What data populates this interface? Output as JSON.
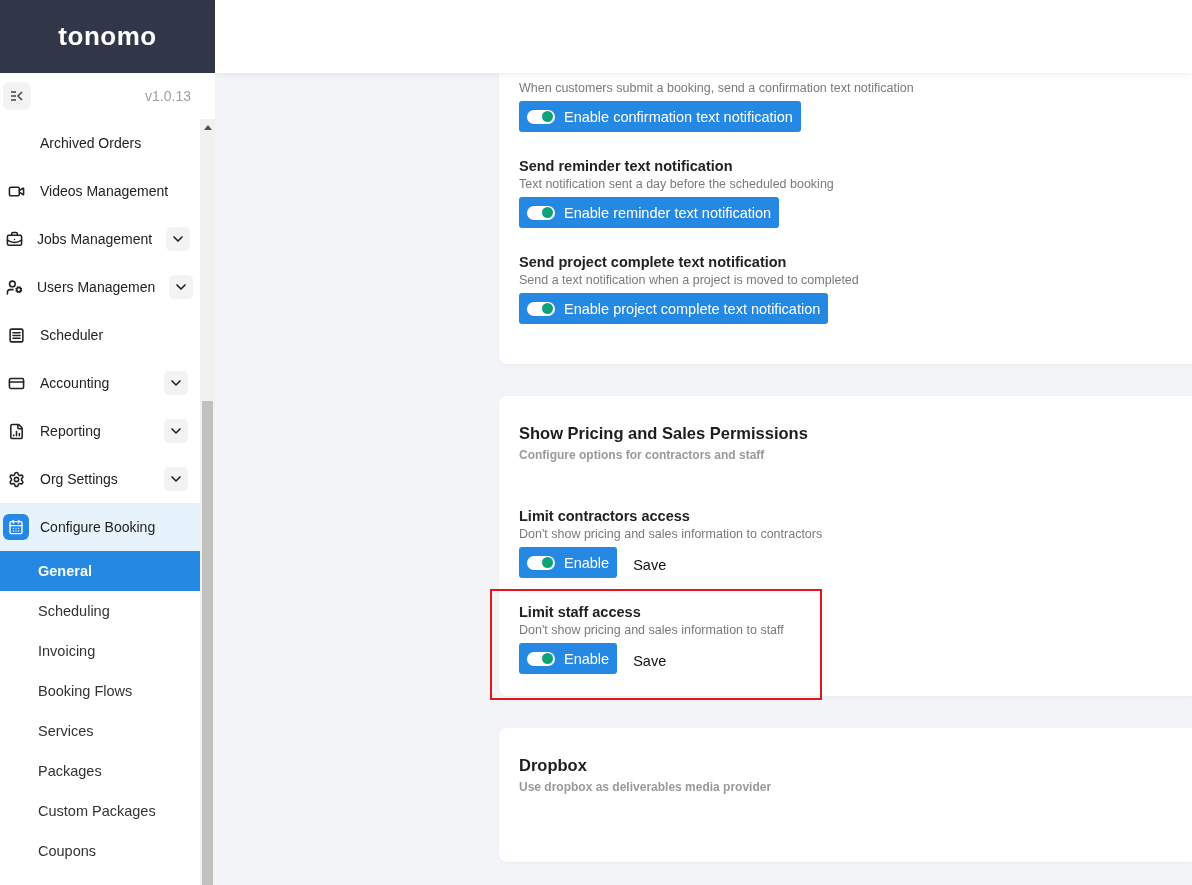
{
  "logo": "tonomo",
  "version": "v1.0.13",
  "sidebar": {
    "items": [
      {
        "label": "Archived Orders",
        "expandable": false,
        "selected": false
      },
      {
        "label": "Videos Management",
        "expandable": false,
        "selected": false
      },
      {
        "label": "Jobs Management",
        "expandable": true,
        "selected": false
      },
      {
        "label": "Users Managemen",
        "expandable": true,
        "selected": false
      },
      {
        "label": "Scheduler",
        "expandable": false,
        "selected": false
      },
      {
        "label": "Accounting",
        "expandable": true,
        "selected": false
      },
      {
        "label": "Reporting",
        "expandable": true,
        "selected": false
      },
      {
        "label": "Org Settings",
        "expandable": true,
        "selected": false
      },
      {
        "label": "Configure Booking",
        "expandable": false,
        "selected": true,
        "children": [
          {
            "label": "General",
            "selected": true
          },
          {
            "label": "Scheduling",
            "selected": false
          },
          {
            "label": "Invoicing",
            "selected": false
          },
          {
            "label": "Booking Flows",
            "selected": false
          },
          {
            "label": "Services",
            "selected": false
          },
          {
            "label": "Packages",
            "selected": false
          },
          {
            "label": "Custom Packages",
            "selected": false
          },
          {
            "label": "Coupons",
            "selected": false
          }
        ]
      }
    ]
  },
  "cards": [
    {
      "clipped": true,
      "settings": [
        {
          "description": "When customers submit a booking, send a confirmation text notification",
          "toggle": {
            "label": "Enable confirmation text notification",
            "on": true
          },
          "highlighted": false
        },
        {
          "title": "Send reminder text notification",
          "description": "Text notification sent a day before the scheduled booking",
          "toggle": {
            "label": "Enable reminder text notification",
            "on": true
          },
          "highlighted": false
        },
        {
          "title": "Send project complete text notification",
          "description": "Send a text notification when a project is moved to completed",
          "toggle": {
            "label": "Enable project complete text notification",
            "on": true
          },
          "highlighted": false
        }
      ]
    },
    {
      "clipped": false,
      "title": "Show Pricing and Sales Permissions",
      "subtitle": "Configure options for contractors and staff",
      "settings": [
        {
          "title": "Limit contractors access",
          "description": "Don't show pricing and sales information to contractors",
          "toggle": {
            "label": "Enable",
            "on": true
          },
          "save": "Save",
          "highlighted": false
        },
        {
          "title": "Limit staff access",
          "description": "Don't show pricing and sales information to staff",
          "toggle": {
            "label": "Enable",
            "on": true
          },
          "save": "Save",
          "highlighted": true
        }
      ]
    },
    {
      "clipped": false,
      "title": "Dropbox",
      "subtitle": "Use dropbox as deliverables media provider"
    }
  ]
}
